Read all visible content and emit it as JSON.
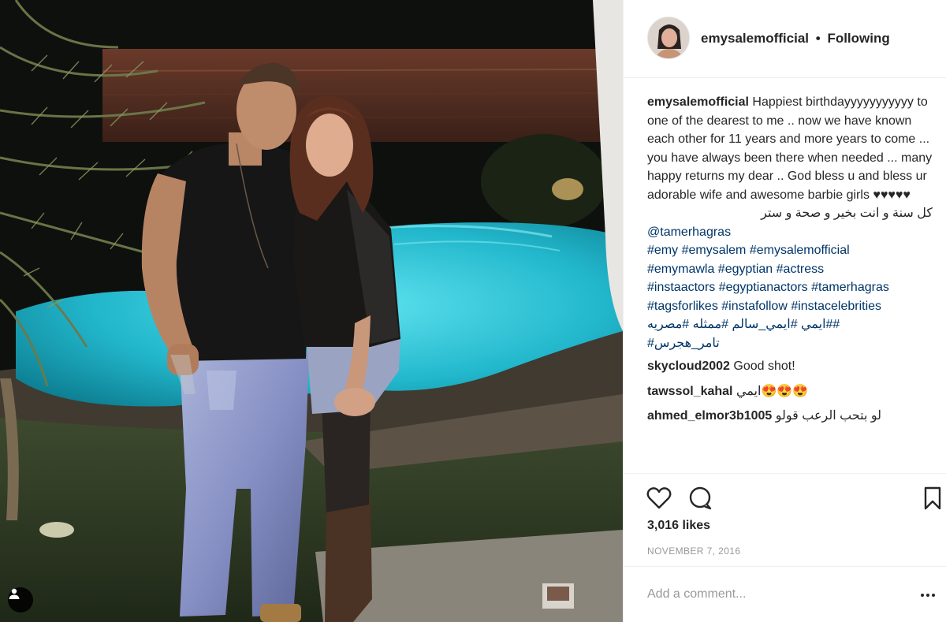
{
  "post": {
    "username": "emysalemofficial",
    "follow_status": "Following",
    "separator": "•"
  },
  "caption": {
    "text": "Happiest birthdayyyyyyyyyyy to one of the dearest to me .. now we have known each other for 11 years and more years to come ... you have always been there when needed ... many happy returns my dear .. God bless u and bless ur adorable wife and awesome barbie girls ♥♥♥♥♥",
    "arabic_line": "كل سنة و انت بخير و صحة و ستر",
    "mention": "@tamerhagras",
    "hashtags_line1": "#emy #emysalem #emysalemofficial",
    "hashtags_line2": "#emymawla #egyptian #actress",
    "hashtags_line3": "#instaactors #egyptianactors #tamerhagras",
    "hashtags_line4": "#tagsforlikes #instafollow #instacelebrities",
    "hashtags_arabic1": "ايمي #ايمي_سالم #ممثله #مصريه##",
    "hashtags_arabic2": "#تامر_هجرس"
  },
  "comments": [
    {
      "user": "skycloud2002",
      "text": "Good shot!"
    },
    {
      "user": "tawssol_kahal",
      "text": "ايمي😍😍😍"
    },
    {
      "user": "ahmed_elmor3b1005",
      "text": "لو بتحب الرعب قولو"
    }
  ],
  "stats": {
    "likes": "3,016 likes",
    "date": "NOVEMBER 7, 2016"
  },
  "composer": {
    "placeholder": "Add a comment..."
  },
  "icons": {
    "like": "heart-icon",
    "comment": "comment-bubble-icon",
    "save": "bookmark-icon",
    "more": "more-options-icon",
    "tagged": "person-tag-icon"
  },
  "colors": {
    "text": "#262626",
    "link": "#003569",
    "muted": "#999999",
    "border": "#efefef",
    "pool": "#2ec5d8"
  }
}
